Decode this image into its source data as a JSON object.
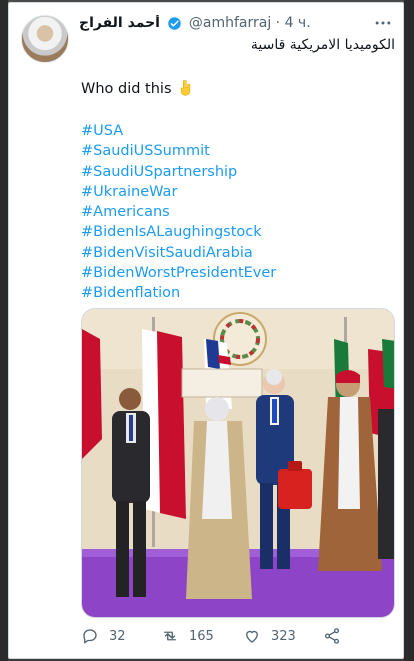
{
  "tweet": {
    "display_name": "أحمد الفراج",
    "handle": "@amhfarraj",
    "separator": "·",
    "time": "4 ч.",
    "rtl_text": "الكوميديا الامريكية قاسية",
    "body": "Who did this",
    "emoji": "pointing-down-emoji",
    "hashtags": [
      "#USA",
      "#SaudiUSSummit",
      "#SaudiUSpartnership",
      "#UkraineWar",
      "#Americans",
      "#BidenIsALaughingstock",
      "#BidenVisitSaudiArabia",
      "#BidenWorstPresidentEver",
      "#Bidenflation"
    ],
    "actions": {
      "reply_count": "32",
      "retweet_count": "165",
      "like_count": "323"
    }
  },
  "colors": {
    "link": "#1d9bf0",
    "text": "#0f1419",
    "muted": "#536471",
    "verified": "#1d9bf0"
  }
}
